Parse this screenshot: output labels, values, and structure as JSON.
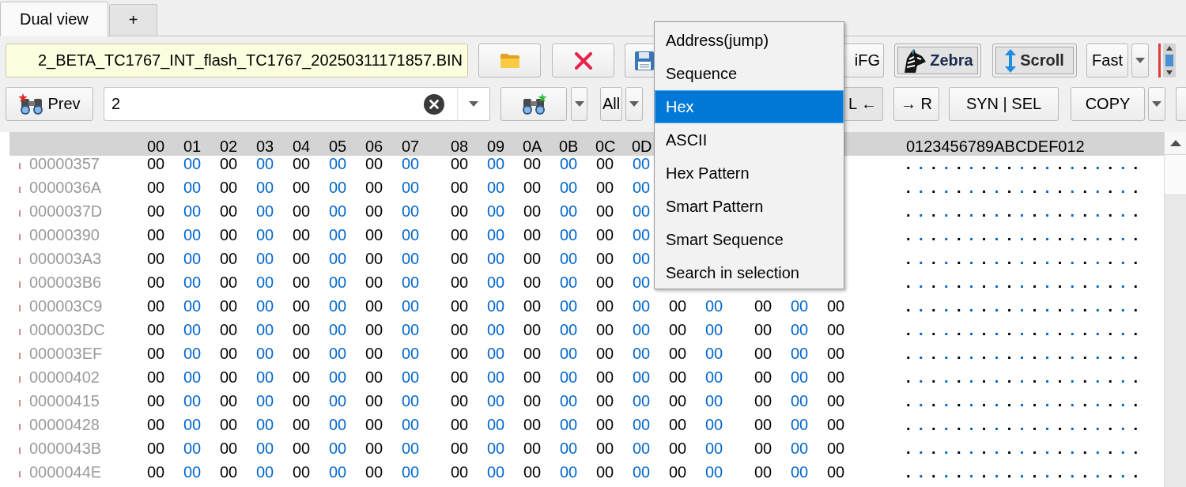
{
  "tabs": [
    {
      "label": "Dual view",
      "selected": true
    },
    {
      "label": "+",
      "selected": false
    }
  ],
  "toolbar": {
    "file_field": {
      "value": "2_BETA_TC1767_INT_flash_TC1767_20250311171857.BIN"
    },
    "cut_button": {
      "label": "iFG"
    },
    "toggles": [
      {
        "kind": "zebra",
        "label": "Zebra",
        "on": true
      },
      {
        "kind": "scroll",
        "label": "Scroll",
        "on": true
      }
    ],
    "speed_dropdown": {
      "value": "Fast"
    }
  },
  "search_bar": {
    "prev_button": {
      "label": "Prev"
    },
    "search_field": {
      "value": "2"
    },
    "scope_dropdown": {
      "value": "All"
    },
    "cut_button": {
      "label": "L ←"
    },
    "buttons": [
      {
        "label": "→ R"
      },
      {
        "label": "SYN | SEL"
      }
    ],
    "copy_button": {
      "label": "COPY"
    }
  },
  "search_menu": {
    "items": [
      {
        "label": "Address(jump)",
        "selected": false
      },
      {
        "label": "Sequence",
        "selected": false
      },
      {
        "label": "Hex",
        "selected": true
      },
      {
        "label": "ASCII",
        "selected": false
      },
      {
        "label": "Hex Pattern",
        "selected": false
      },
      {
        "label": "Smart Pattern",
        "selected": false
      },
      {
        "label": "Smart Sequence",
        "selected": false
      },
      {
        "label": "Search in selection",
        "selected": false
      }
    ]
  },
  "hex_view": {
    "column_headers": [
      "00",
      "01",
      "02",
      "03",
      "04",
      "05",
      "06",
      "07",
      "08",
      "09",
      "0A",
      "0B",
      "0C",
      "0D"
    ],
    "ascii_header": "0123456789ABCDEF012",
    "rows": [
      {
        "address": "00000357",
        "bytes": [
          "00",
          "00",
          "00",
          "00",
          "00",
          "00",
          "00",
          "00",
          "00",
          "00",
          "00",
          "00",
          "00",
          "00"
        ],
        "ascii": "..................."
      },
      {
        "address": "0000036A",
        "bytes": [
          "00",
          "00",
          "00",
          "00",
          "00",
          "00",
          "00",
          "00",
          "00",
          "00",
          "00",
          "00",
          "00",
          "00"
        ],
        "ascii": "..................."
      },
      {
        "address": "0000037D",
        "bytes": [
          "00",
          "00",
          "00",
          "00",
          "00",
          "00",
          "00",
          "00",
          "00",
          "00",
          "00",
          "00",
          "00",
          "00"
        ],
        "ascii": "..................."
      },
      {
        "address": "00000390",
        "bytes": [
          "00",
          "00",
          "00",
          "00",
          "00",
          "00",
          "00",
          "00",
          "00",
          "00",
          "00",
          "00",
          "00",
          "00"
        ],
        "ascii": "..................."
      },
      {
        "address": "000003A3",
        "bytes": [
          "00",
          "00",
          "00",
          "00",
          "00",
          "00",
          "00",
          "00",
          "00",
          "00",
          "00",
          "00",
          "00",
          "00"
        ],
        "ascii": "..................."
      },
      {
        "address": "000003B6",
        "bytes": [
          "00",
          "00",
          "00",
          "00",
          "00",
          "00",
          "00",
          "00",
          "00",
          "00",
          "00",
          "00",
          "00",
          "00"
        ],
        "ascii": "..................."
      },
      {
        "address": "000003C9",
        "bytes": [
          "00",
          "00",
          "00",
          "00",
          "00",
          "00",
          "00",
          "00",
          "00",
          "00",
          "00",
          "00",
          "00",
          "00",
          "00",
          "00",
          "00",
          "00",
          "00"
        ],
        "ascii": "..................."
      },
      {
        "address": "000003DC",
        "bytes": [
          "00",
          "00",
          "00",
          "00",
          "00",
          "00",
          "00",
          "00",
          "00",
          "00",
          "00",
          "00",
          "00",
          "00",
          "00",
          "00",
          "00",
          "00",
          "00"
        ],
        "ascii": "..................."
      },
      {
        "address": "000003EF",
        "bytes": [
          "00",
          "00",
          "00",
          "00",
          "00",
          "00",
          "00",
          "00",
          "00",
          "00",
          "00",
          "00",
          "00",
          "00",
          "00",
          "00",
          "00",
          "00",
          "00"
        ],
        "ascii": "..................."
      },
      {
        "address": "00000402",
        "bytes": [
          "00",
          "00",
          "00",
          "00",
          "00",
          "00",
          "00",
          "00",
          "00",
          "00",
          "00",
          "00",
          "00",
          "00",
          "00",
          "00",
          "00",
          "00",
          "00"
        ],
        "ascii": "..................."
      },
      {
        "address": "00000415",
        "bytes": [
          "00",
          "00",
          "00",
          "00",
          "00",
          "00",
          "00",
          "00",
          "00",
          "00",
          "00",
          "00",
          "00",
          "00",
          "00",
          "00",
          "00",
          "00",
          "00"
        ],
        "ascii": "..................."
      },
      {
        "address": "00000428",
        "bytes": [
          "00",
          "00",
          "00",
          "00",
          "00",
          "00",
          "00",
          "00",
          "00",
          "00",
          "00",
          "00",
          "00",
          "00",
          "00",
          "00",
          "00",
          "00",
          "00"
        ],
        "ascii": "..................."
      },
      {
        "address": "0000043B",
        "bytes": [
          "00",
          "00",
          "00",
          "00",
          "00",
          "00",
          "00",
          "00",
          "00",
          "00",
          "00",
          "00",
          "00",
          "00",
          "00",
          "00",
          "00",
          "00",
          "00"
        ],
        "ascii": "..................."
      },
      {
        "address": "0000044E",
        "bytes": [
          "00",
          "00",
          "00",
          "00",
          "00",
          "00",
          "00",
          "00",
          "00",
          "00",
          "00",
          "00",
          "00",
          "00",
          "00",
          "00",
          "00",
          "00",
          "00"
        ],
        "ascii": "..................."
      }
    ]
  }
}
